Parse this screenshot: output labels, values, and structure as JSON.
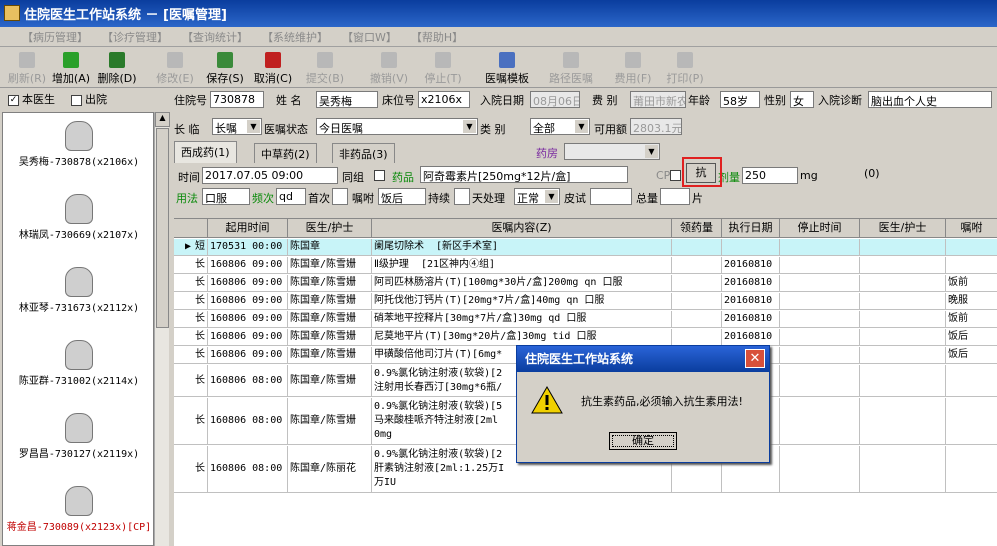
{
  "window": {
    "title": "住院医生工作站系统 － [医嘱管理]"
  },
  "menu": [
    "【病历管理】",
    "【诊疗管理】",
    "【查询统计】",
    "【系统维护】",
    "【窗口W】",
    "【帮助H】"
  ],
  "toolbar": [
    {
      "label": "刷新(R)",
      "enabled": false,
      "icon": "refresh-icon"
    },
    {
      "label": "增加(A)",
      "enabled": true,
      "icon": "add-icon"
    },
    {
      "label": "删除(D)",
      "enabled": true,
      "icon": "delete-icon"
    },
    {
      "label": "修改(E)",
      "enabled": false,
      "icon": "edit-icon"
    },
    {
      "label": "保存(S)",
      "enabled": true,
      "icon": "save-icon"
    },
    {
      "label": "取消(C)",
      "enabled": true,
      "icon": "undo-icon"
    },
    {
      "label": "提交(B)",
      "enabled": false,
      "icon": "submit-icon"
    },
    {
      "label": "撤销(V)",
      "enabled": false,
      "icon": "revoke-icon"
    },
    {
      "label": "停止(T)",
      "enabled": false,
      "icon": "stop-icon"
    },
    {
      "label": "医嘱模板",
      "enabled": true,
      "icon": "template-icon"
    },
    {
      "label": "路径医嘱",
      "enabled": false,
      "icon": "path-icon"
    },
    {
      "label": "费用(F)",
      "enabled": false,
      "icon": "fee-icon"
    },
    {
      "label": "打印(P)",
      "enabled": false,
      "icon": "print-icon"
    }
  ],
  "left": {
    "my_patients": "本医生",
    "discharged": "出院",
    "patients": [
      {
        "name": "吴秀梅-730878(x2106x)",
        "color": "#000000"
      },
      {
        "name": "林瑞凤-730669(x2107x)",
        "color": "#000000"
      },
      {
        "name": "林亚琴-731673(x2112x)",
        "color": "#000000"
      },
      {
        "name": "陈亚群-731002(x2114x)",
        "color": "#000000"
      },
      {
        "name": "罗昌昌-730127(x2119x)",
        "color": "#000000"
      },
      {
        "name": "蒋金昌-730089(x2123x)[CP]",
        "color": "#c00000"
      }
    ]
  },
  "form": {
    "admission_no_label": "住院号",
    "admission_no": "730878",
    "name_label": "姓  名",
    "name": "吴秀梅",
    "bed_label": "床位号",
    "bed": "x2106x",
    "admit_date_label": "入院日期",
    "admit_date": "08月06日",
    "fee_label": "费  别",
    "fee": "莆田市新农",
    "age_label": "年龄",
    "age": "58岁",
    "sex_label": "性别",
    "sex": "女",
    "diag_label": "入院诊断",
    "diag": "脑出血个人史",
    "duration_label": "长  临",
    "duration": "长嘱",
    "status_label": "医嘱状态",
    "status": "今日医嘱",
    "category_label": "类    别",
    "category": "全部",
    "avail_label": "可用额",
    "avail": "2803.1元",
    "tabs": [
      "西成药(1)",
      "中草药(2)",
      "非药品(3)"
    ],
    "pharmacy_label": "药房",
    "time_label": "时间",
    "time": "2017.07.05 09:00",
    "group_label": "同组",
    "drug_label": "药品",
    "drug": "阿奇霉素片[250mg*12片/盒]",
    "cp_label": "CP",
    "anti_button": "抗",
    "dose_label": "剂量",
    "dose": "250",
    "dose_unit": "mg",
    "zero": "(0)",
    "usage_label": "用法",
    "usage": "口服",
    "freq_label": "频次",
    "freq": "qd",
    "first_label": "首次",
    "order_label": "嘱咐",
    "order": "饭后",
    "continuous_label": "持续",
    "days_label": "天处理",
    "days": "正常",
    "skin_label": "皮试",
    "total_label": "总量",
    "total_unit": "片"
  },
  "grid": {
    "headers": [
      "起用时间",
      "医生/护士",
      "医嘱内容(Z)",
      "领药量",
      "执行日期",
      "停止时间",
      "医生/护士",
      "嘱咐"
    ],
    "rows": [
      {
        "t": "短",
        "start": "170531 00:00",
        "doc": "陈国章",
        "content": "阑尾切除术  [新区手术室]",
        "exec": "",
        "note": ""
      },
      {
        "t": "长",
        "start": "160806 09:00",
        "doc": "陈国章/陈雪姗",
        "content": "Ⅱ级护理  [21区神内④组]",
        "exec": "20160810",
        "note": ""
      },
      {
        "t": "长",
        "start": "160806 09:00",
        "doc": "陈国章/陈雪姗",
        "content": "阿司匹林肠溶片(T)[100mg*30片/盒]200mg qn 口服",
        "exec": "20160810",
        "note": "饭前"
      },
      {
        "t": "长",
        "start": "160806 09:00",
        "doc": "陈国章/陈雪姗",
        "content": "阿托伐他汀钙片(T)[20mg*7片/盒]40mg qn 口服",
        "exec": "20160810",
        "note": "晚服"
      },
      {
        "t": "长",
        "start": "160806 09:00",
        "doc": "陈国章/陈雪姗",
        "content": "硝苯地平控释片[30mg*7片/盒]30mg qd 口服",
        "exec": "20160810",
        "note": "饭前"
      },
      {
        "t": "长",
        "start": "160806 09:00",
        "doc": "陈国章/陈雪姗",
        "content": "尼莫地平片(T)[30mg*20片/盒]30mg tid 口服",
        "exec": "20160810",
        "note": "饭后"
      },
      {
        "t": "长",
        "start": "160806 09:00",
        "doc": "陈国章/陈雪姗",
        "content": "甲磺酸倍他司汀片(T)[6mg*",
        "exec": "",
        "note": "饭后"
      },
      {
        "t": "长",
        "start": "160806 08:00",
        "doc": "陈国章/陈雪姗",
        "content": "0.9%氯化钠注射液(软袋)[2\n注射用长春西汀[30mg*6瓶/",
        "exec": "",
        "note": ""
      },
      {
        "t": "长",
        "start": "160806 08:00",
        "doc": "陈国章/陈雪姗",
        "content": "0.9%氯化钠注射液(软袋)[5\n马来酸桂哌齐特注射液[2ml\n0mg",
        "exec": "",
        "note": ""
      },
      {
        "t": "长",
        "start": "160806 08:00",
        "doc": "陈国章/陈丽花",
        "content": "0.9%氯化钠注射液(软袋)[2\n肝素钠注射液[2ml:1.25万I\n万IU",
        "exec": "",
        "note": ""
      }
    ]
  },
  "dialog": {
    "title": "住院医生工作站系统",
    "message": "抗生素药品,必须输入抗生素用法!",
    "ok": "确定"
  }
}
